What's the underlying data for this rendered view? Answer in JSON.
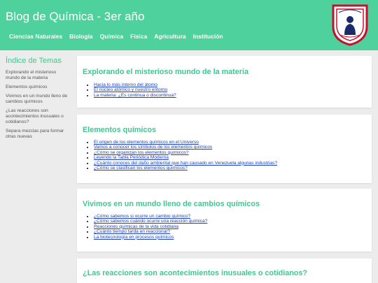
{
  "header": {
    "site_title": "Blog de Química - 3er año",
    "nav": [
      "Ciencias Naturales",
      "Biología",
      "Química",
      "Física",
      "Agricultura",
      "Institución"
    ],
    "logo_icon": "school-crest-icon"
  },
  "sidebar": {
    "title": "Índice de Temas",
    "items": [
      "Explorando el misterioso mundo de la materia",
      "Elementos químicos",
      "Vivimos en un mundo lleno de cambios químicos",
      "¿Las reacciones son acontecimientos inusuales o cotidianos?",
      "Separa mezclas para formar otras nuevas"
    ]
  },
  "sections": [
    {
      "title": "Explorando el misterioso mundo de la materia",
      "links": [
        "Hacia lo más interno del átomo",
        "El núcleo atómico y nuestro entorno",
        "La materia: ¿Es continua o discontinua?"
      ]
    },
    {
      "title": "Elementos químicos",
      "links": [
        "El origen de los elementos químicos en el Universo",
        "Vamos a conocer los símbolos de los elementos químicos",
        "¿Cómo se organizan los elementos químicos?",
        "Leyendo la Tabla Periódica Moderna",
        "¿Cuánto conoces del daño ambiental que han causado en Venezuela algunas industrias?",
        "¿Cómo se clasifican los elementos químicos?"
      ]
    },
    {
      "title": "Vivimos en un mundo lleno de cambios químicos",
      "links": [
        "¿Cómo sabemos si ocurre un cambio químico?",
        "¿Cómo sabemos cuándo ocurre una reacción química?",
        "Reacciones químicas de la vida cotidiana",
        "¿Cuánto tiempo tarda en reaccionar?",
        "La biotecnología en procesos químicos"
      ]
    },
    {
      "title": "¿Las reacciones son acontecimientos inusuales o cotidianos?",
      "links": []
    }
  ],
  "colors": {
    "header": "#4ed19c",
    "accent": "#3cc98f",
    "link": "#1a3fbf"
  }
}
